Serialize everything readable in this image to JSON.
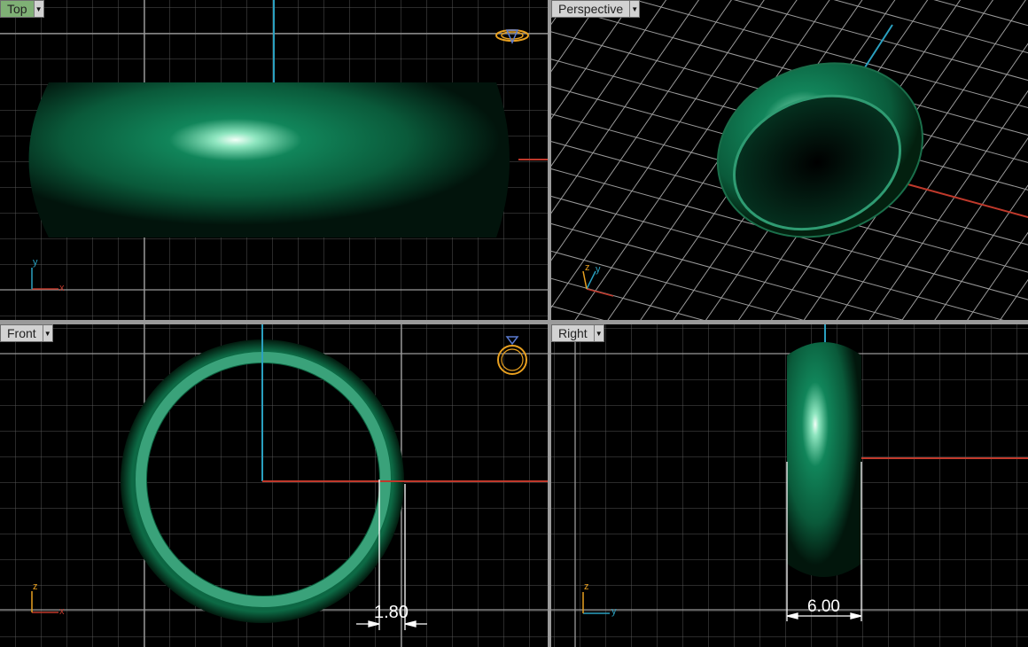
{
  "viewports": {
    "top": {
      "title": "Top",
      "active": true,
      "axis_h": "x",
      "axis_v": "y"
    },
    "perspective": {
      "title": "Perspective",
      "active": false,
      "axis_h": "y",
      "axis_v": "z"
    },
    "front": {
      "title": "Front",
      "active": false,
      "axis_h": "x",
      "axis_v": "z"
    },
    "right": {
      "title": "Right",
      "active": false,
      "axis_h": "y",
      "axis_v": "z"
    }
  },
  "dimensions": {
    "thickness": "1.80",
    "width": "6.00"
  },
  "colors": {
    "grid": "#5a5a5a",
    "grid_major": "#a0a0a0",
    "x_axis": "#c0392b",
    "y_axis": "#2aa0c0",
    "ring_body": "#0b5e3c",
    "ring_light": "#e8fff4",
    "ring_inner": "#3aa27a",
    "gumball": "#e8a020"
  },
  "icons": {
    "tab_menu": "chevron-down-icon",
    "gumball": "ring-widget-icon"
  }
}
